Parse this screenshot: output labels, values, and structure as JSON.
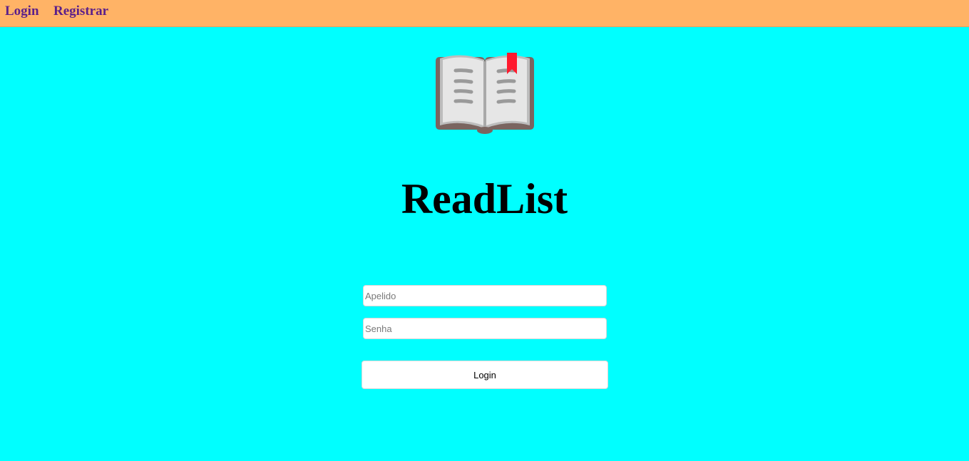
{
  "nav": {
    "login_label": "Login",
    "register_label": "Registrar"
  },
  "logo": {
    "icon": "open-book-icon"
  },
  "app": {
    "title": "ReadList"
  },
  "form": {
    "username_placeholder": "Apelido",
    "username_value": "",
    "password_placeholder": "Senha",
    "password_value": "",
    "submit_label": "Login"
  },
  "colors": {
    "background": "#00ffff",
    "navbar": "#ffb366",
    "nav_link": "#5b1f8a",
    "bookmark": "#ff1a2e"
  }
}
